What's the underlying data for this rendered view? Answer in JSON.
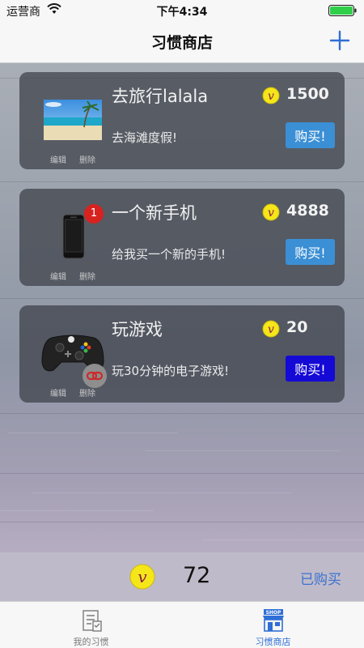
{
  "status_bar": {
    "carrier": "运营商",
    "time": "下午4:34"
  },
  "nav": {
    "title": "习惯商店"
  },
  "items": [
    {
      "title": "去旅行lalala",
      "price": "1500",
      "description": "去海滩度假!",
      "buy_label": "购买!",
      "edit_label": "编辑",
      "delete_label": "删除",
      "thumbnail": "beach-photo"
    },
    {
      "title": "一个新手机",
      "price": "4888",
      "description": "给我买一个新的手机!",
      "buy_label": "购买!",
      "edit_label": "编辑",
      "delete_label": "删除",
      "thumbnail": "phone-icon",
      "badge": "1"
    },
    {
      "title": "玩游戏",
      "price": "20",
      "description": "玩30分钟的电子游戏!",
      "buy_label": "购买!",
      "edit_label": "编辑",
      "delete_label": "删除",
      "thumbnail": "gamepad-icon"
    }
  ],
  "summary": {
    "balance": "72",
    "purchased_label": "已购买"
  },
  "tabs": [
    {
      "label": "我的习惯",
      "icon": "habit-list-icon"
    },
    {
      "label": "习惯商店",
      "icon": "shop-icon",
      "icon_text": "SHOP"
    }
  ],
  "colors": {
    "accent": "#3a72cf",
    "buy_button": "#3b8fd5",
    "buy_button_active": "#1509d6",
    "coin": "#f5e61a",
    "badge": "#d8221f"
  }
}
